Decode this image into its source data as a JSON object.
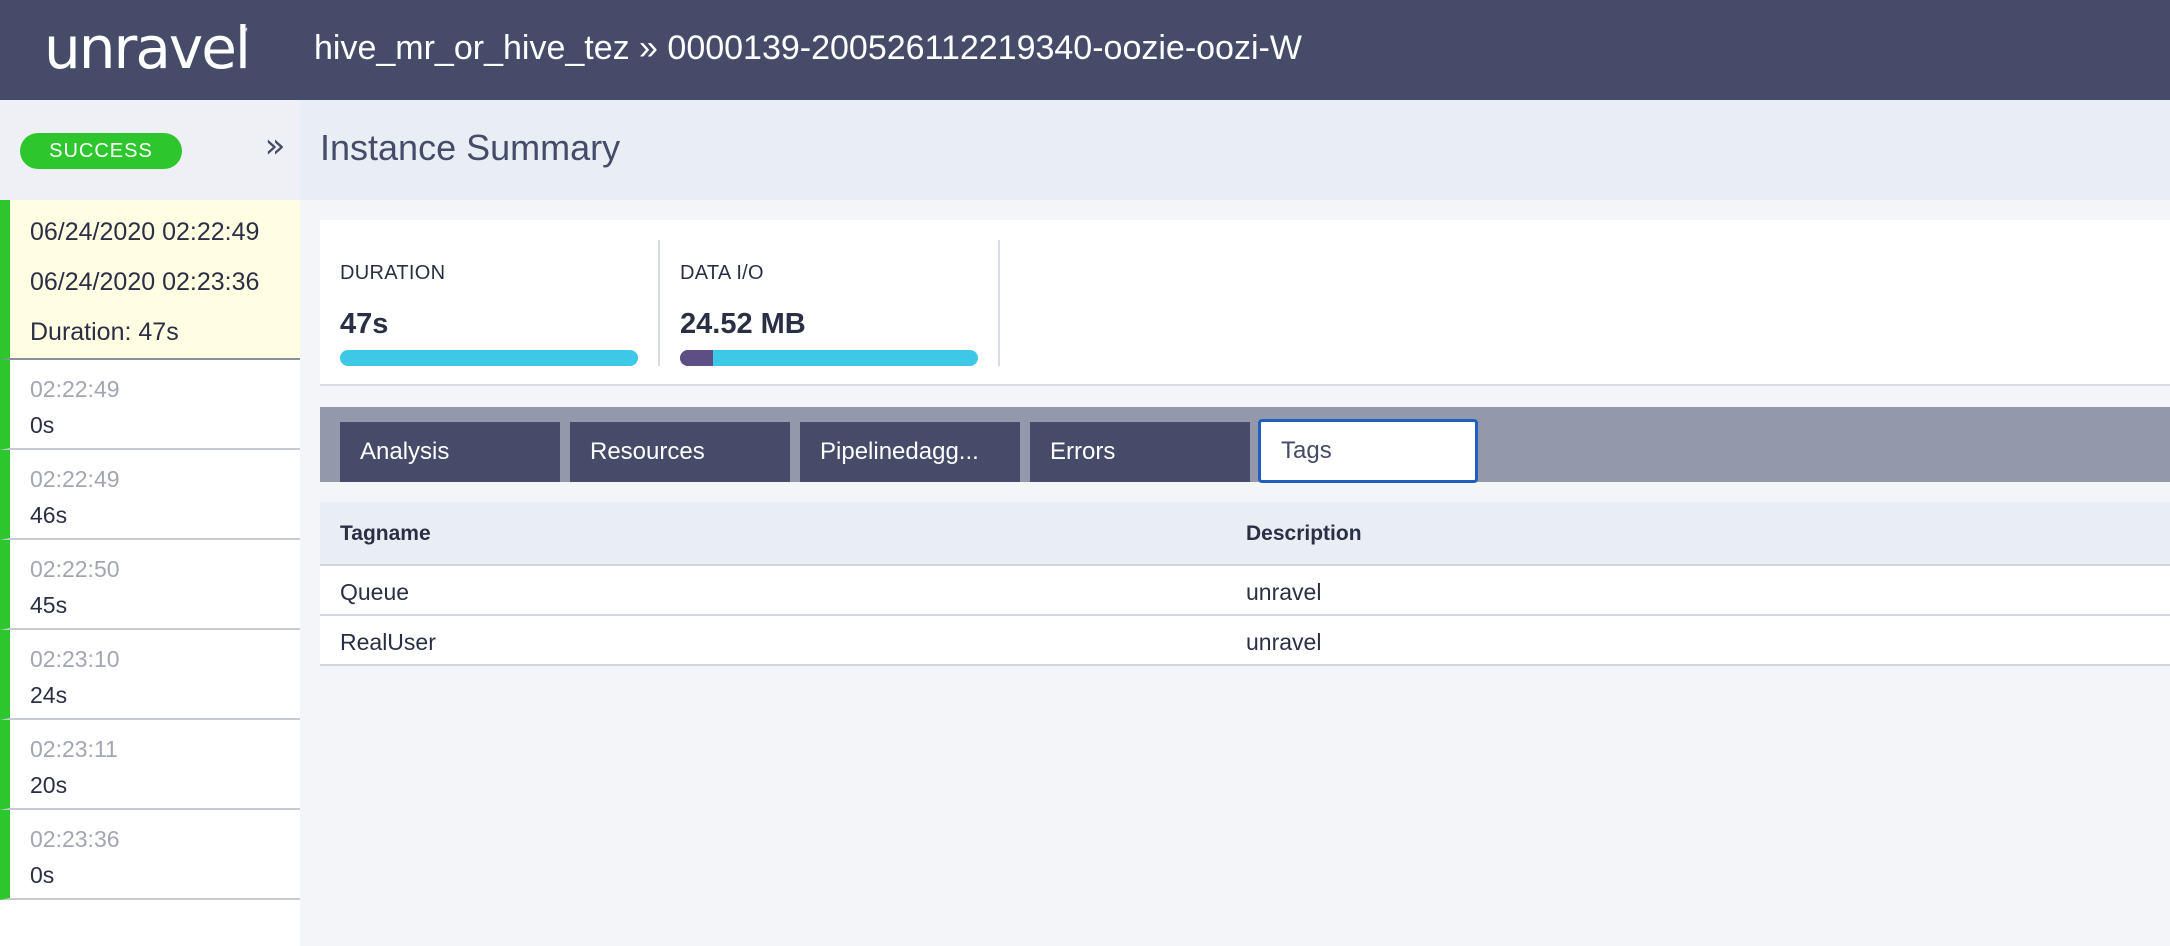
{
  "app": {
    "logo_text": "unravel",
    "logo_tm": "™",
    "breadcrumb": "hive_mr_or_hive_tez » 0000139-200526112219340-oozie-oozi-W"
  },
  "sidebar": {
    "status": "SUCCESS",
    "collapse_glyph": "»",
    "summary": {
      "start": "06/24/2020 02:22:49",
      "end": "06/24/2020 02:23:36",
      "duration": "Duration: 47s"
    },
    "items": [
      {
        "time": "02:22:49",
        "duration": "0s"
      },
      {
        "time": "02:22:49",
        "duration": "46s"
      },
      {
        "time": "02:22:50",
        "duration": "45s"
      },
      {
        "time": "02:23:10",
        "duration": "24s"
      },
      {
        "time": "02:23:11",
        "duration": "20s"
      },
      {
        "time": "02:23:36",
        "duration": "0s"
      }
    ]
  },
  "main": {
    "title": "Instance Summary",
    "kpis": [
      {
        "label": "DURATION",
        "value": "47s",
        "purple_fraction": 0.0
      },
      {
        "label": "DATA I/O",
        "value": "24.52 MB",
        "purple_fraction": 0.11
      }
    ],
    "tabs": [
      {
        "label": "Analysis",
        "active": false
      },
      {
        "label": "Resources",
        "active": false
      },
      {
        "label": "Pipelinedagg...",
        "active": false
      },
      {
        "label": "Errors",
        "active": false
      },
      {
        "label": "Tags",
        "active": true
      }
    ],
    "table": {
      "headers": [
        "Tagname",
        "Description"
      ],
      "rows": [
        [
          "Queue",
          "unravel"
        ],
        [
          "RealUser",
          "unravel"
        ]
      ]
    }
  },
  "colors": {
    "topbar": "#454b68",
    "success": "#2dc62d",
    "bar_primary": "#3ec8e8",
    "bar_secondary": "#5d4f85",
    "active_tab_border": "#1f5fbf"
  }
}
